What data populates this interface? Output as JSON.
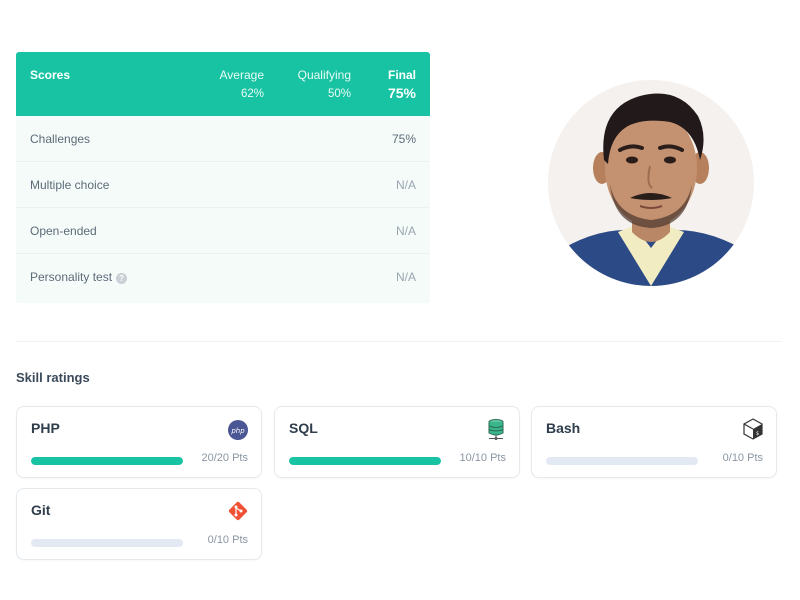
{
  "scores": {
    "title": "Scores",
    "average_label": "Average",
    "average_value": "62%",
    "qualifying_label": "Qualifying",
    "qualifying_value": "50%",
    "final_label": "Final",
    "final_value": "75%",
    "rows": [
      {
        "label": "Challenges",
        "value": "75%"
      },
      {
        "label": "Multiple choice",
        "value": "N/A"
      },
      {
        "label": "Open-ended",
        "value": "N/A"
      },
      {
        "label": "Personality test",
        "value": "N/A"
      }
    ]
  },
  "skills": {
    "title": "Skill ratings",
    "items": [
      {
        "name": "PHP",
        "points": "20/20 Pts",
        "progress": 1.0,
        "icon": "php-icon"
      },
      {
        "name": "SQL",
        "points": "10/10 Pts",
        "progress": 1.0,
        "icon": "database-icon"
      },
      {
        "name": "Bash",
        "points": "0/10 Pts",
        "progress": 0.0,
        "icon": "bash-icon"
      },
      {
        "name": "Git",
        "points": "0/10 Pts",
        "progress": 0.0,
        "icon": "git-icon"
      }
    ]
  },
  "colors": {
    "accent": "#17c3a2",
    "track": "#e3e9f3"
  }
}
